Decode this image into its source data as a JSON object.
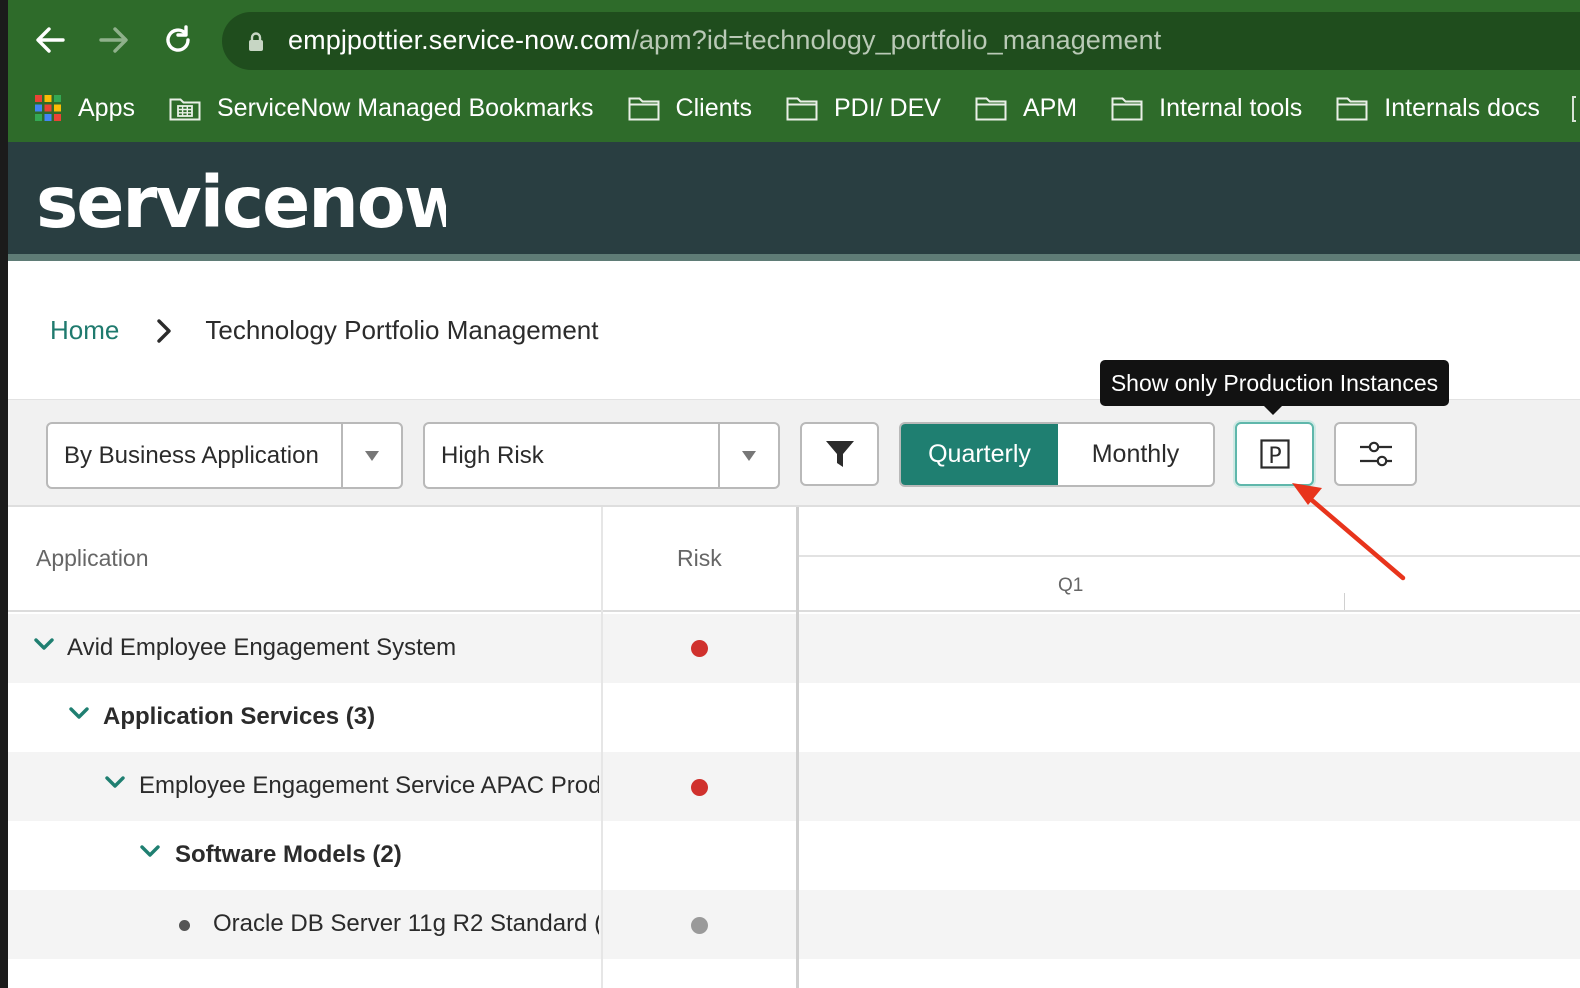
{
  "browser": {
    "url_host": "empjpottier.service-now.com",
    "url_path": "/apm?id=technology_portfolio_management",
    "bookmarks": [
      {
        "label": "Apps",
        "icon": "apps-grid-icon"
      },
      {
        "label": "ServiceNow Managed Bookmarks",
        "icon": "managed-folder-icon"
      },
      {
        "label": "Clients",
        "icon": "folder-icon"
      },
      {
        "label": "PDI/ DEV",
        "icon": "folder-icon"
      },
      {
        "label": "APM",
        "icon": "folder-icon"
      },
      {
        "label": "Internal tools",
        "icon": "folder-icon"
      },
      {
        "label": "Internals docs",
        "icon": "folder-icon"
      }
    ]
  },
  "brand": {
    "logo_text": "servicenow"
  },
  "breadcrumb": {
    "home": "Home",
    "current": "Technology Portfolio Management"
  },
  "toolbar": {
    "group_by": "By Business Application",
    "risk_filter": "High Risk",
    "period_active": "Quarterly",
    "period_inactive": "Monthly",
    "tooltip": "Show only Production Instances",
    "prod_label": "P"
  },
  "grid": {
    "col_application": "Application",
    "col_risk": "Risk",
    "timeline_label": "Q1",
    "rows": [
      {
        "label": "Avid Employee Engagement System",
        "risk": "high",
        "expanded": true
      },
      {
        "label": "Application Services (3)",
        "risk": "",
        "expanded": true
      },
      {
        "label": "Employee Engagement Service APAC Prod",
        "risk": "high",
        "expanded": true
      },
      {
        "label": "Software Models (2)",
        "risk": "",
        "expanded": true
      },
      {
        "label": "Oracle DB Server 11g R2 Standard (",
        "risk": "none",
        "expanded": false
      }
    ]
  },
  "colors": {
    "chrome_green": "#2e6b2a",
    "sn_header": "#293e41",
    "accent_teal": "#1f7f71",
    "risk_high": "#d0312d",
    "risk_none": "#9a9a9a",
    "annotation_arrow": "#e8341c"
  }
}
